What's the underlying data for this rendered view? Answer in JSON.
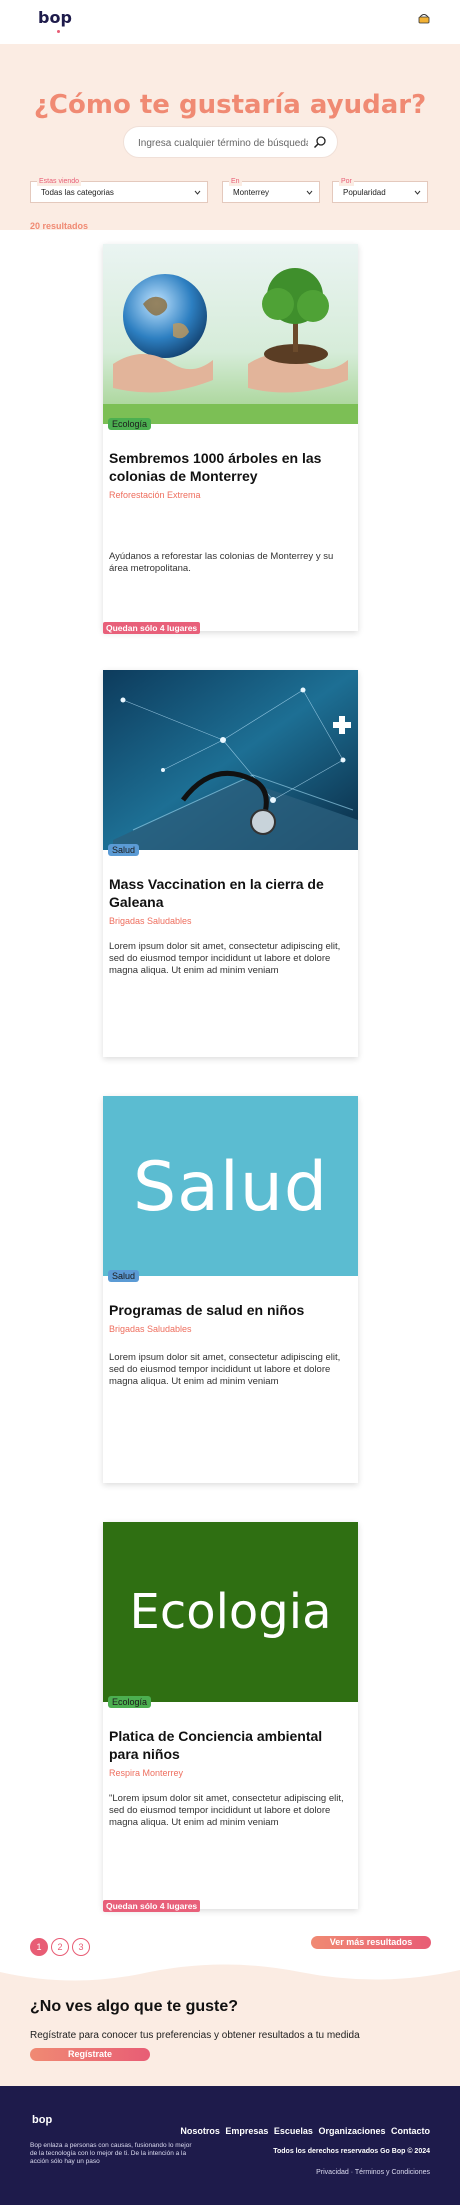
{
  "header": {
    "logo": "bop",
    "cart_icon": "shopping-basket-icon"
  },
  "hero": {
    "title": "¿Cómo te gustaría ayudar?",
    "search_placeholder": "Ingresa cualquier término de búsqueda"
  },
  "filters": [
    {
      "label": "Estas viendo",
      "value": "Todas las categorias"
    },
    {
      "label": "En",
      "value": "Monterrey"
    },
    {
      "label": "Por",
      "value": "Popularidad"
    }
  ],
  "results_count": "20 resultados",
  "cards": [
    {
      "badge": "Ecología",
      "title": "Sembremos 1000 árboles en las colonias de Monterrey",
      "organization": "Reforestación Extrema",
      "description": "Ayúdanos a reforestar las colonias de Monterrey y su área metropolitana.",
      "spots": "Quedan sólo 4 lugares",
      "image": "earth-and-tree-in-hands"
    },
    {
      "badge": "Salud",
      "title": "Mass Vaccination en la cierra de Galeana",
      "organization": "Brigadas Saludables",
      "description": "Lorem ipsum dolor sit amet, consectetur adipiscing elit, sed do eiusmod tempor incididunt ut labore et dolore magna aliqua. Ut enim ad minim veniam",
      "spots": "",
      "image": "stethoscope-and-laptop"
    },
    {
      "badge": "Salud",
      "title": "Programas de salud en niños",
      "organization": "Brigadas Saludables",
      "description": "Lorem ipsum dolor sit amet, consectetur adipiscing elit, sed do eiusmod tempor incididunt ut labore et dolore magna aliqua. Ut enim ad minim veniam",
      "spots": "",
      "image_text": "Salud"
    },
    {
      "badge": "Ecología",
      "title": "Platica de Conciencia ambiental para niños",
      "organization": "Respira Monterrey",
      "description": "\"Lorem ipsum dolor sit amet, consectetur adipiscing elit, sed do eiusmod tempor incididunt ut labore et dolore magna aliqua. Ut enim ad minim veniam",
      "spots": "Quedan sólo 4 lugares",
      "image_text": "Ecologia"
    }
  ],
  "pagination": {
    "pages": [
      "1",
      "2",
      "3"
    ],
    "current": "1",
    "more_label": "Ver más resultados"
  },
  "cta": {
    "title": "¿No ves algo que te guste?",
    "text": "Regístrate para conocer tus preferencias y obtener resultados a tu medida",
    "button": "Regístrate"
  },
  "footer": {
    "logo": "bop",
    "about": "Bop enlaza a personas con causas, fusionando lo mejor de la tecnología con lo mejor de ti. De la intención a la acción sólo hay un paso",
    "links": [
      "Nosotros",
      "Empresas",
      "Escuelas",
      "Organizaciones",
      "Contacto"
    ],
    "rights": "Todos los derechos reservados Go Bop © 2024",
    "legal": "Privacidad · Términos y Condiciones"
  },
  "colors": {
    "accent": "#e85d75",
    "hero_title": "#f08a73",
    "hero_bg": "#fbece3",
    "footer_bg": "#1e1b4b",
    "eco_badge": "#4caf50",
    "salud_badge": "#5b9bd5",
    "salud_image": "#5bbcd1",
    "ecologia_image": "#2f6f12"
  }
}
